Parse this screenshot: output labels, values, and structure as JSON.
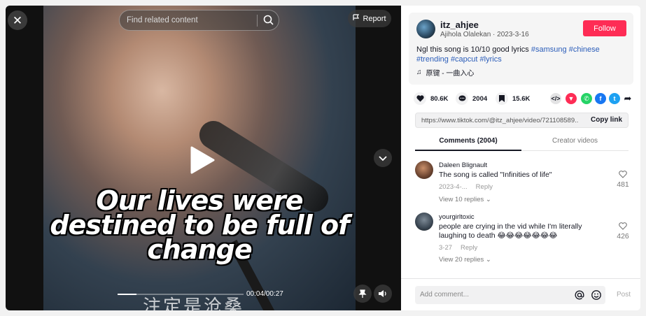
{
  "video": {
    "search_placeholder": "Find related content",
    "report_label": "Report",
    "caption_line1": "Our lives were",
    "caption_line2": "destined to be full of",
    "caption_line3": "change",
    "subtitle_cn": "注定是沧桑",
    "time": "00:04/00:27",
    "progress_fraction": 0.15
  },
  "post": {
    "username": "itz_ahjee",
    "author_name": "Ajihola Olalekan",
    "date": "2023-3-16",
    "follow_label": "Follow",
    "desc_text": "Ngl this song is 10/10 good lyrics ",
    "hashtags": [
      "#samsung",
      "#chinese",
      "#trending",
      "#capcut",
      "#lyrics"
    ],
    "music": "原键 - 一曲入心"
  },
  "actions": {
    "likes": "80.6K",
    "comments": "2004",
    "saves": "15.6K"
  },
  "link": {
    "url": "https://www.tiktok.com/@itz_ahjee/video/721108589...",
    "copy_label": "Copy link"
  },
  "tabs": {
    "comments": "Comments (2004)",
    "creator": "Creator videos"
  },
  "comments": [
    {
      "user": "Daleen Blignault",
      "text": "The song is called \"Infinities of life\"",
      "date": "2023-4-...",
      "reply": "Reply",
      "replies": "View 10 replies",
      "likes": "481"
    },
    {
      "user": "yourgirltoxic",
      "text": "people are crying in the vid while I'm literally laughing to death 😂😂😂😂😂😂😂",
      "date": "3-27",
      "reply": "Reply",
      "replies": "View 20 replies",
      "likes": "426"
    }
  ],
  "comment_bar": {
    "placeholder": "Add comment...",
    "post_label": "Post"
  },
  "colors": {
    "accent": "#fe2c55",
    "hashtag": "#2b5db9",
    "whatsapp": "#25d366",
    "facebook": "#1877f2",
    "twitter": "#1da1f2"
  }
}
